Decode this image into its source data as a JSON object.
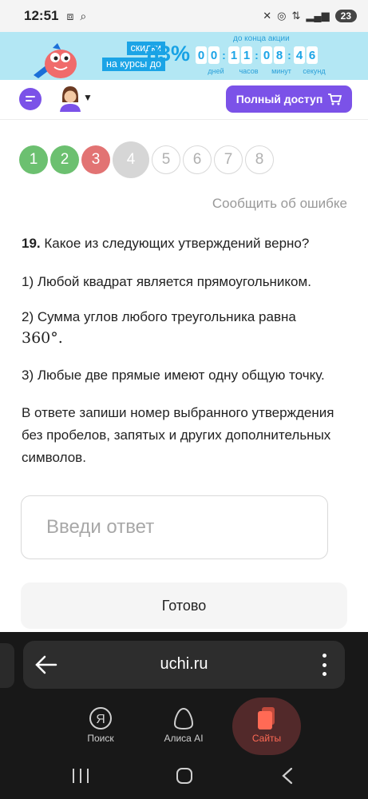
{
  "status_bar": {
    "time": "12:51",
    "battery": "23"
  },
  "promo": {
    "label_line1": "скидки",
    "label_line2": "на курсы до",
    "percent": "83%",
    "countdown_title": "до конца акции",
    "digits": [
      "0",
      "0",
      "1",
      "1",
      "0",
      "8",
      "4",
      "6"
    ],
    "units": [
      "дней",
      "часов",
      "минут",
      "секунд"
    ],
    "accent_color": "#1ba4e6"
  },
  "header": {
    "full_access_label": "Полный доступ",
    "brand_color": "#7b52e8"
  },
  "steps": [
    {
      "label": "1",
      "state": "correct"
    },
    {
      "label": "2",
      "state": "correct"
    },
    {
      "label": "3",
      "state": "wrong"
    },
    {
      "label": "4",
      "state": "current"
    },
    {
      "label": "5",
      "state": "pending"
    },
    {
      "label": "6",
      "state": "pending"
    },
    {
      "label": "7",
      "state": "pending"
    },
    {
      "label": "8",
      "state": "pending"
    }
  ],
  "report_link": "Сообщить об ошибке",
  "task": {
    "number": "19.",
    "question": "Какое из следующих утверждений верно?",
    "statement1": "1) Любой квадрат является прямоугольником.",
    "statement2_text": "2) Сумма углов любого треугольника равна",
    "statement2_math": "360°.",
    "statement3": "3) Любые две прямые имеют одну общую точку.",
    "instruction": "В ответе запиши номер выбранного утверждения без пробелов, запятых и других дополнительных символов."
  },
  "answer": {
    "placeholder": "Введи ответ",
    "value": ""
  },
  "done_button": "Готово",
  "browser": {
    "url": "uchi.ru"
  },
  "bottom_tabs": {
    "search": "Поиск",
    "alice": "Алиса AI",
    "sites": "Сайты",
    "search_icon_letter": "Я"
  }
}
